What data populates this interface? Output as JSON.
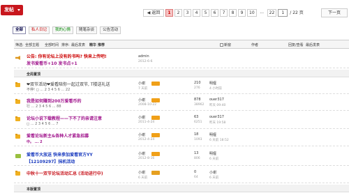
{
  "toolbar": {
    "post_label": "发帖"
  },
  "pager": {
    "prev_label": "◀ 返回",
    "pages": [
      "1",
      "2",
      "3",
      "4",
      "5",
      "6",
      "7",
      "8",
      "9",
      "10",
      "...",
      "22"
    ],
    "current": "1",
    "input_value": "1",
    "total": "/ 22 页",
    "next_label": "下一页"
  },
  "tabs": [
    "全部",
    "私人日记",
    "我的心情",
    "随笔杂谈",
    "公告活动"
  ],
  "table_header": {
    "filter": "筛选:",
    "filter_theme": "全部主题",
    "filter_time": "全部时间",
    "sort_label": "排序:",
    "sort_value": "最后发表",
    "digest": "精华",
    "recommend": "推荐",
    "new_window": "新窗",
    "author_col": "作者",
    "stats_col": "回复/查看",
    "last_col": "最后发表"
  },
  "announcement": {
    "line1": "公告: 你有论坛上没有的书吗? 快来上传吧!",
    "line2": "发书爱看币+10 发书点+1",
    "author": "admin",
    "date": "2012-6-6"
  },
  "sections": {
    "global_top": "全局置顶",
    "new_topics": "本版置顶"
  },
  "threads": [
    {
      "title": "❤双节活动❤爱看陪你一起过双节, T楼送礼送",
      "subtitle": "不停! ◻ ... 2 3 4 5 6 ... 22",
      "author": "小谢",
      "author_date": "7 天前",
      "replies": "210",
      "views": "276",
      "last_user": "明偃",
      "last_time": "4 小时前"
    },
    {
      "title": "我是如何赚到200万爱看币的",
      "subtitle": "行 ... 2 3 4 5 6 ... 88",
      "author": "小谢",
      "author_date": "2008-10-22",
      "replies": "878",
      "views": "38962",
      "last_user": "ouer317",
      "last_time": "昨天 09:40"
    },
    {
      "title": "论坛小说下载教程——下不了的亲请注意",
      "subtitle": "◻ ... 2 3 4 5 6 ... 7",
      "author": "小谢",
      "author_date": "2011-4-24",
      "replies": "63",
      "views": "6251",
      "last_user": "ouer317",
      "last_time": "昨天 19:58"
    },
    {
      "title": "爱看论坛新主&各种人才紧急招募",
      "subtitle": "中。 ...  2",
      "author": "小谢",
      "author_date": "2012-4-24",
      "replies": "18",
      "views": "1093",
      "last_user": "明偃",
      "last_time": "6 天前 18:52"
    },
    {
      "title": "爱看币大放送  快来参加爱看官方YY",
      "subtitle": "【12109297】抹机活动",
      "author": "小谢",
      "author_date": "2012-8-16",
      "replies": "13",
      "views": "806",
      "last_user": "明偃",
      "last_time": "6 天前"
    },
    {
      "title": "中秋十一双节论坛活动汇总 (活动进行中)",
      "subtitle": "",
      "author": "小谢",
      "author_date": "6 天前",
      "replies": "0",
      "views": "64",
      "last_user": "小谢",
      "last_time": "6 天前"
    }
  ]
}
